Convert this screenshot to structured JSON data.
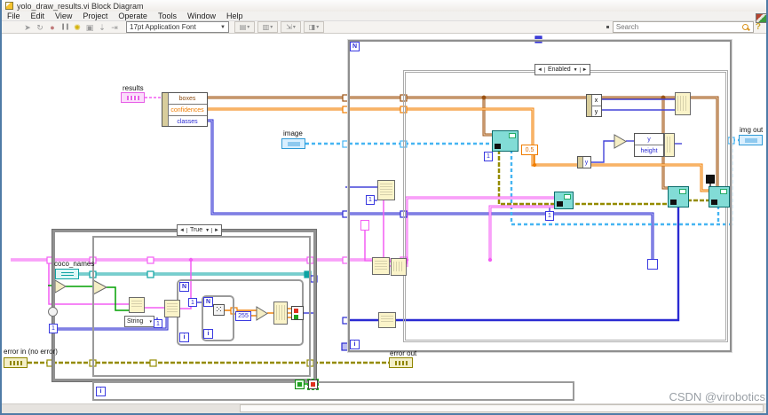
{
  "window": {
    "title": "yolo_draw_results.vi Block Diagram"
  },
  "menu": {
    "items": [
      "File",
      "Edit",
      "View",
      "Project",
      "Operate",
      "Tools",
      "Window",
      "Help"
    ]
  },
  "toolbar": {
    "font_selector": "17pt Application Font",
    "search_placeholder": "Search",
    "help_glyph": "?",
    "icons": [
      {
        "name": "run",
        "glyph": "➤"
      },
      {
        "name": "run-continuous",
        "glyph": "↻"
      },
      {
        "name": "abort",
        "glyph": "●"
      },
      {
        "name": "pause",
        "glyph": "❙❙"
      },
      {
        "name": "highlight-execution",
        "glyph": "✺"
      },
      {
        "name": "retain-wire-values",
        "glyph": "▣"
      },
      {
        "name": "step-into",
        "glyph": "⇣"
      },
      {
        "name": "step-over",
        "glyph": "⇥"
      }
    ],
    "dropdown_icons": [
      {
        "name": "align-objects",
        "glyph": "▤"
      },
      {
        "name": "distribute-objects",
        "glyph": "▥"
      },
      {
        "name": "resize-objects",
        "glyph": "⇲"
      },
      {
        "name": "reorder-objects",
        "glyph": "◨"
      }
    ]
  },
  "diagram": {
    "structures": {
      "disable_label": "Enabled",
      "case_label": "True",
      "arrow_left": "◄",
      "arrow_right": "►",
      "arrow_down": "▼"
    },
    "terminals": {
      "results": "results",
      "image": "image",
      "coco_names": "coco_names",
      "error_in": "error in (no error)",
      "error_out": "error out",
      "img_out": "img out"
    },
    "unbundle_fields": [
      "boxes",
      "confidences",
      "classes"
    ],
    "cluster_fields": {
      "x": "x",
      "y": "y",
      "y2": "y",
      "height": "height"
    },
    "constants": {
      "half": "0.5",
      "c255": "255",
      "one": "1"
    },
    "string_selector": "String",
    "loop_glyphs": {
      "count": "N",
      "iteration": "i"
    },
    "watermark": "CSDN @virobotics"
  },
  "colors": {
    "wire_brown": "#9b5212",
    "wire_orange": "#f07d00",
    "wire_blue": "#2a2ad2",
    "wire_pink": "#f35df3",
    "wire_cyan": "#45b5f2",
    "wire_teal": "#0da3a3",
    "wire_error": "#948b00",
    "wire_green": "#00a000",
    "node_teal": "#82dcd6",
    "node_cream": "#fbf4c9",
    "structure_gray": "#9a9a9a"
  }
}
